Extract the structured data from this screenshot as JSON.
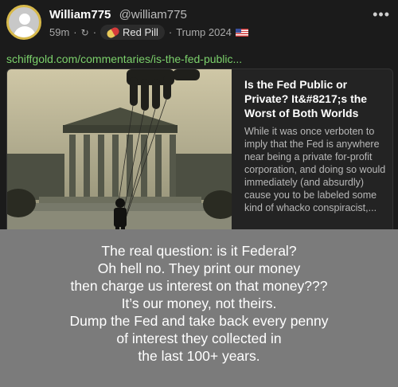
{
  "post": {
    "author_name": "William775",
    "author_handle": "@william775",
    "time": "59m",
    "sep1": "·",
    "sep2": "·",
    "sep3": "·",
    "badge_label": "Red Pill",
    "tagline": "Trump 2024",
    "more": "•••",
    "link": "schiffgold.com/commentaries/is-the-fed-public..."
  },
  "card": {
    "title": "Is the Fed Public or Private? It&#8217;s the Worst of Both Worlds",
    "description": "While it was once verboten to imply that the Fed is anywhere near being a private for-profit corporation, and doing so would immediately (and absurdly) cause you to be labeled some kind of whacko conspiracist,..."
  },
  "overlay": {
    "lines": [
      "The real question: is it Federal?",
      "Oh hell no. They print our money",
      "then charge us interest on that money???",
      "It’s our money, not theirs.",
      "Dump the Fed and take back every penny",
      "of interest they collected in",
      "the last 100+ years."
    ]
  }
}
